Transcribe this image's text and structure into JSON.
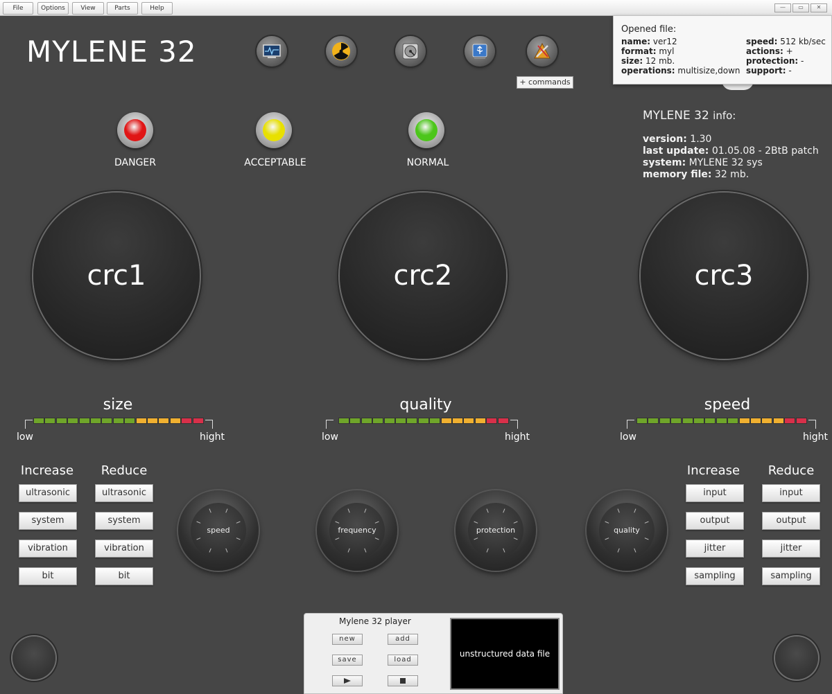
{
  "menubar": {
    "items": [
      "File",
      "Options",
      "View",
      "Parts",
      "Help"
    ],
    "window_buttons": [
      "—",
      "▭",
      "✕"
    ]
  },
  "app": {
    "title": "MYLENE 32"
  },
  "toolbar": {
    "icons": [
      "activity-monitor-icon",
      "radiation-icon",
      "hard-drive-icon",
      "usb-drive-icon",
      "tools-icon"
    ],
    "commands_label": "+ commands"
  },
  "file_panel": {
    "header": "Opened file:",
    "left": [
      {
        "label": "name:",
        "value": "ver12"
      },
      {
        "label": "format:",
        "value": "myl"
      },
      {
        "label": "size:",
        "value": "12 mb."
      },
      {
        "label": "operations:",
        "value": "multisize,down"
      }
    ],
    "right": [
      {
        "label": "speed:",
        "value": "512 kb/sec"
      },
      {
        "label": "actions:",
        "value": "+"
      },
      {
        "label": "protection:",
        "value": "-"
      },
      {
        "label": "support:",
        "value": "-"
      }
    ]
  },
  "info": {
    "title_name": "MYLENE 32",
    "title_suffix": "info:",
    "rows": [
      {
        "label": "version:",
        "value": "1.30"
      },
      {
        "label": "last update:",
        "value": "01.05.08 - 2BtB patch"
      },
      {
        "label": "system:",
        "value": "MYLENE 32 sys"
      },
      {
        "label": "memory file:",
        "value": "32 mb."
      }
    ]
  },
  "leds": [
    {
      "label": "DANGER",
      "color": "#e01515"
    },
    {
      "label": "ACCEPTABLE",
      "color": "#e8e000"
    },
    {
      "label": "NORMAL",
      "color": "#4cc61a"
    }
  ],
  "circles": [
    "crc1",
    "crc2",
    "crc3"
  ],
  "meters": [
    {
      "title": "size",
      "low": "low",
      "high": "hight"
    },
    {
      "title": "quality",
      "low": "low",
      "high": "hight"
    },
    {
      "title": "speed",
      "low": "low",
      "high": "hight"
    }
  ],
  "meter_colors": [
    "#6fa52a",
    "#6fa52a",
    "#6fa52a",
    "#6fa52a",
    "#6fa52a",
    "#6fa52a",
    "#6fa52a",
    "#6fa52a",
    "#6fa52a",
    "#f0b030",
    "#f0b030",
    "#f0b030",
    "#f0b030",
    "#d8304a",
    "#d8304a"
  ],
  "left_controls": {
    "increase": "Increase",
    "reduce": "Reduce",
    "buttons": [
      "ultrasonic",
      "system",
      "vibration",
      "bit"
    ]
  },
  "right_controls": {
    "increase": "Increase",
    "reduce": "Reduce",
    "buttons": [
      "input",
      "output",
      "jitter",
      "sampling"
    ]
  },
  "dials": [
    "speed",
    "frequency",
    "protection",
    "quality"
  ],
  "player": {
    "title": "Mylene 32 player",
    "new": "new",
    "add": "add",
    "save": "save",
    "load": "load",
    "screen_text": "unstructured data file"
  }
}
